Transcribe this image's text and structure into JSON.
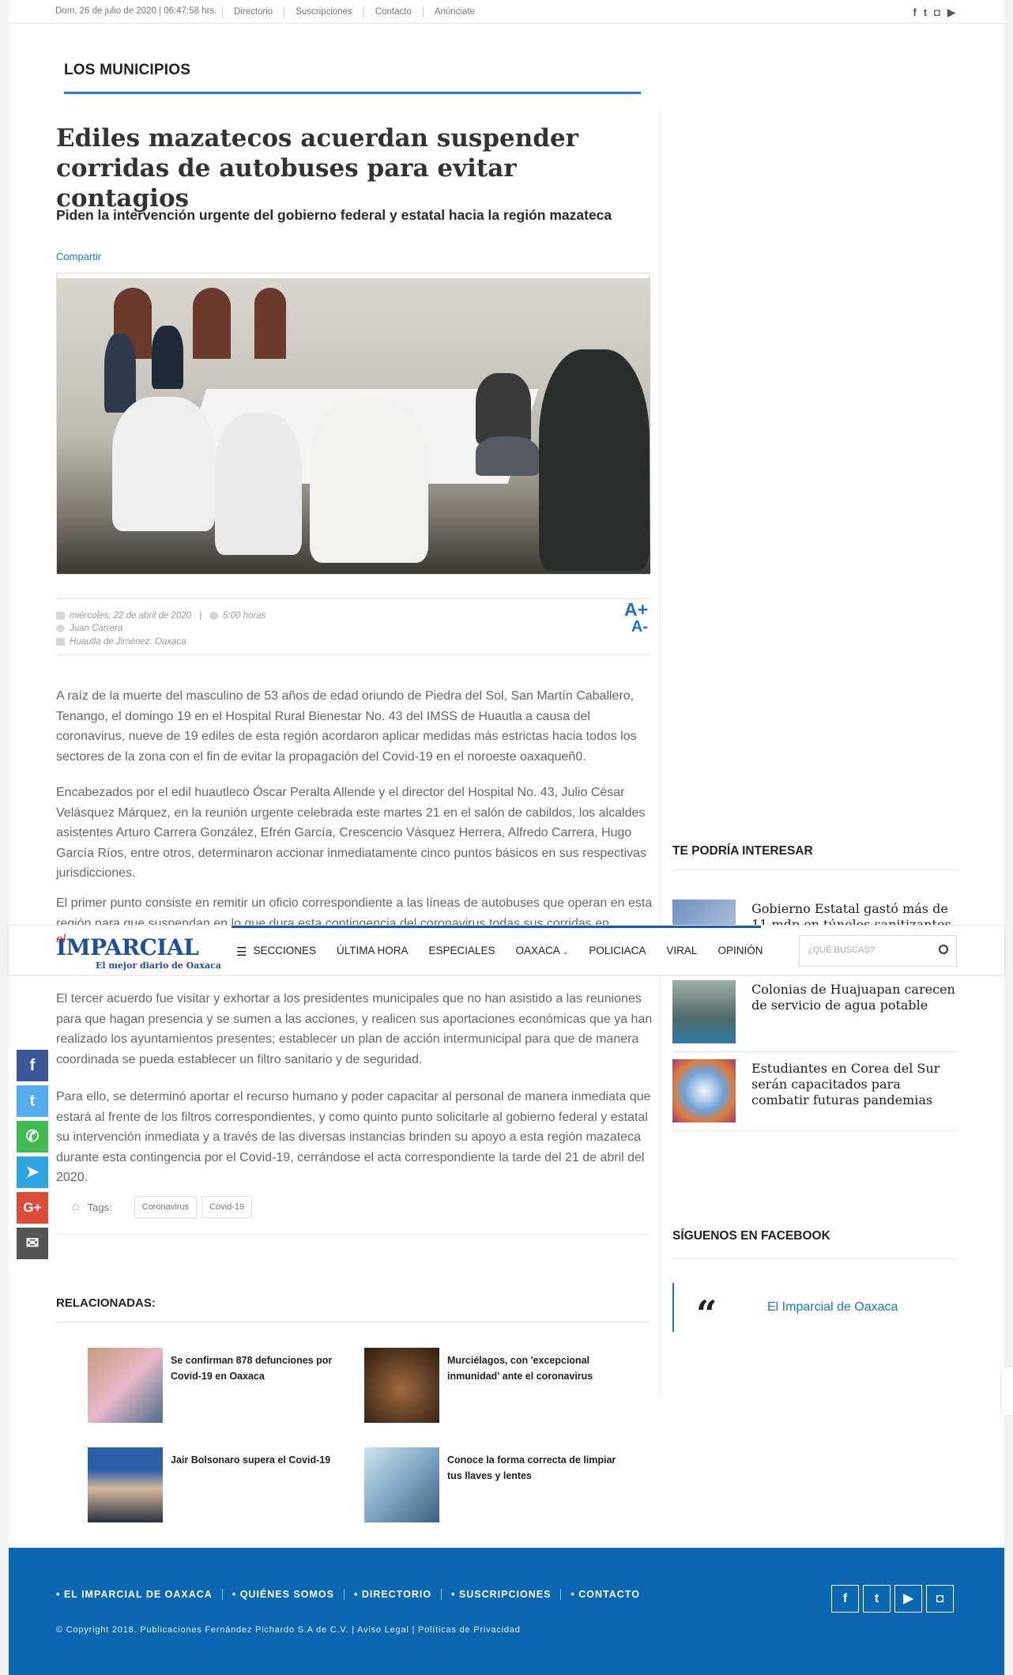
{
  "topbar": {
    "date": "Dom, 26 de julio de 2020 | 06:47:58 hrs.",
    "links": [
      "Directorio",
      "Suscripciones",
      "Contacto",
      "Anúnciate"
    ],
    "socials": [
      "f",
      "t",
      "ig",
      "yt"
    ]
  },
  "section": {
    "title": "LOS MUNICIPIOS"
  },
  "article": {
    "headline": "Ediles mazatecos acuerdan suspender corridas de autobuses para evitar contagios",
    "subhead": "Piden la intervención urgente del gobierno federal y estatal hacia la región mazateca",
    "share_label": "Compartir",
    "date": "miércoles, 22 de abril de 2020",
    "time": "5:00 horas",
    "author": "Juan Carrera",
    "location": "Huautla de Jiménez, Oaxaca",
    "font_plus": "A+",
    "font_minus": "A-",
    "paragraphs": [
      "A raíz de la muerte del masculino de 53 años de edad oriundo de Piedra del Sol, San Martín Caballero, Tenango, el domingo 19 en el Hospital Rural Bienestar No. 43 del IMSS de Huautla a causa del coronavirus, nueve de 19  ediles de esta región acordaron aplicar medidas más estrictas hacia todos los sectores de la zona con el fin de evitar la propagación del Covid-19 en el noroeste oaxaqueñ0.",
      "Encabezados por el edil huautleco Óscar Peralta Allende y el director del Hospital No. 43, Julio César Velásquez Márquez, en la reunión urgente celebrada este martes 21 en el salón de cabildos, los alcaldes asistentes Arturo Carrera González, Efrén García, Crescencio Vásquez Herrera, Alfredo Carrera, Hugo García Ríos, entre otros, determinaron accionar inmediatamente cinco puntos básicos en sus respectivas jurisdicciones.",
      "El primer punto consiste en remitir un oficio correspondiente a las líneas de autobuses que operan en esta región para que suspendan en lo que dura esta contingencia del coronavirus todas sus corridas en",
      "El tercer acuerdo fue visitar y exhortar a los presidentes municipales que no han asistido a las reuniones para que hagan presencia y se sumen a las acciones, y realicen sus aportaciones económicas que ya han realizado los ayuntamientos presentes; establecer un plan de acción intermunicipal para que de manera coordinada se pueda establecer un filtro sanitario y de seguridad.",
      "Para ello, se determinó aportar el recurso humano y poder capacitar al personal de manera inmediata que estará al frente de los filtros correspondientes, y como quinto punto solicitarle al gobierno federal y estatal su intervención inmediata y a través de las diversas instancias brinden su apoyo a esta región mazateca durante esta contingencia por el Covid-19, cerrándose el acta correspondiente la tarde del 21 de abril del 2020."
    ],
    "tags_label": "Tags:",
    "tags": [
      "Coronavirus",
      "Covid-19"
    ]
  },
  "nav": {
    "logo_el": "el",
    "logo_main": "IMPARCIAL",
    "logo_tagline": "El mejor diario de Oaxaca",
    "items": [
      "SECCIONES",
      "ÚLTIMA HORA",
      "ESPECIALES",
      "OAXACA",
      "POLICIACA",
      "VIRAL",
      "OPINIÓN"
    ],
    "search_placeholder": "¿QUÉ BUSCAS?"
  },
  "share_buttons": [
    "facebook",
    "twitter",
    "whatsapp",
    "telegram",
    "google-plus",
    "email"
  ],
  "related": {
    "title": "RELACIONADAS:",
    "items": [
      "Se confirman 878 defunciones por Covid-19 en Oaxaca",
      "Murciélagos, con 'excepcional inmunidad' ante el coronavirus",
      "Jair Bolsonaro supera el Covid-19",
      "Conoce la forma correcta de limpiar tus llaves y lentes"
    ]
  },
  "sidebar": {
    "interest_title": "TE PODRÍA INTERESAR",
    "items": [
      "Gobierno Estatal gastó más de 11 mdp en túneles sanitizantes",
      "Colonias de Huajuapan carecen de servicio de agua potable",
      "Estudiantes en Corea del Sur serán capacitados para combatir futuras pandemias"
    ],
    "facebook_title": "SÍGUENOS EN FACEBOOK",
    "facebook_page": "El Imparcial de Oaxaca",
    "quote_mark": "“"
  },
  "footer": {
    "links": [
      "• EL IMPARCIAL DE OAXACA",
      "• QUIÉNES SOMOS",
      "• DIRECTORIO",
      "• SUSCRIPCIONES",
      "• CONTACTO"
    ],
    "copyright": "© Copyright 2018. Publicaciones Fernández Pichardo S.A de C.V. | Aviso Legal | Políticas de Privacidad",
    "socials": [
      "f",
      "t",
      "yt",
      "ig"
    ]
  },
  "colors": {
    "accent": "#1e73be",
    "footer": "#0b67b2",
    "section_line": "#2a7dc6"
  }
}
